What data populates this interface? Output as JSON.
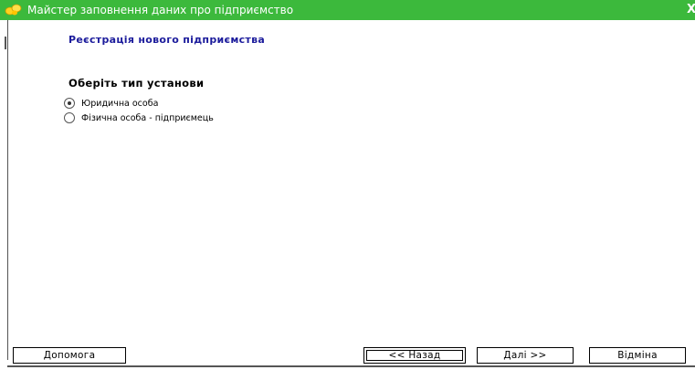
{
  "window": {
    "title": "Майстер заповнення даних про підприємство",
    "icon": "app-icon",
    "close_glyph": "X",
    "titlebar_color": "#3cb93c"
  },
  "page": {
    "heading": "Реєстрація нового підприємства",
    "group_label": "Оберіть тип установи",
    "heading_color": "#1c1c9c"
  },
  "options": [
    {
      "label": "Юридична особа",
      "checked": true
    },
    {
      "label": "Фізична особа - підприємець",
      "checked": false
    }
  ],
  "buttons": {
    "help": "Допомога",
    "back": "<< Назад",
    "next": "Далі >>",
    "cancel": "Відміна"
  }
}
